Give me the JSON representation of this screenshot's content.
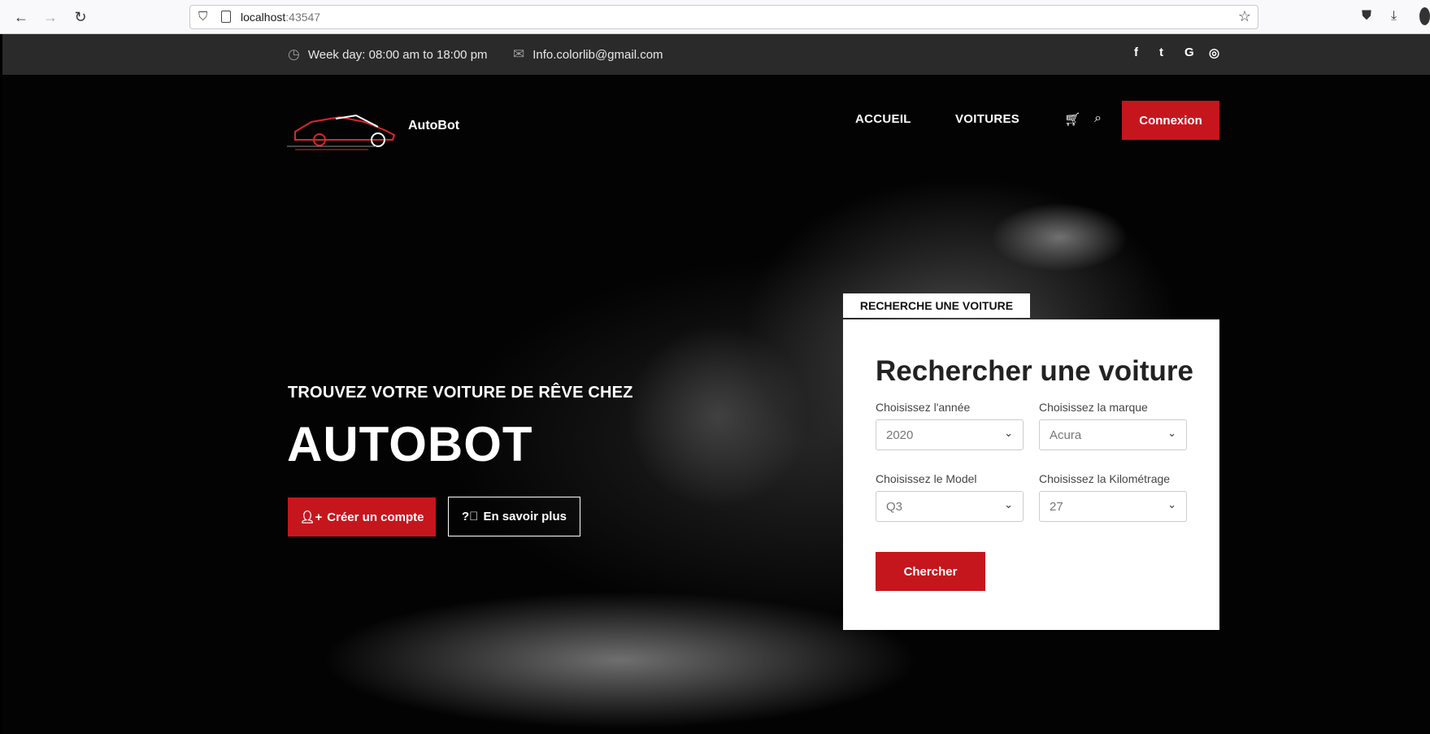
{
  "browser": {
    "url_host": "localhost",
    "url_port": ":43547"
  },
  "topbar": {
    "hours": "Week day: 08:00 am to 18:00 pm",
    "email": "Info.colorlib@gmail.com",
    "social": [
      "facebook-icon",
      "twitter-icon",
      "google-icon",
      "instagram-icon"
    ]
  },
  "header": {
    "brand": "AutoBot",
    "menu": [
      "ACCUEIL",
      "VOITURES"
    ],
    "login": "Connexion"
  },
  "hero": {
    "subtitle": "TROUVEZ VOTRE VOITURE DE RÊVE CHEZ",
    "title": "AUTOBOT",
    "create_account": "Créer un compte",
    "learn_more": "En savoir plus"
  },
  "search": {
    "tab": "RECHERCHE UNE VOITURE",
    "title": "Rechercher une voiture",
    "year_label": "Choisissez l'année",
    "year_value": "2020",
    "brand_label": "Choisissez la marque",
    "brand_value": "Acura",
    "model_label": "Choisissez le Model",
    "model_value": "Q3",
    "km_label": "Choisissez la Kilométrage",
    "km_value": "27",
    "submit": "Chercher"
  },
  "colors": {
    "accent": "#c5161d",
    "topbar": "#2a2a2a"
  }
}
